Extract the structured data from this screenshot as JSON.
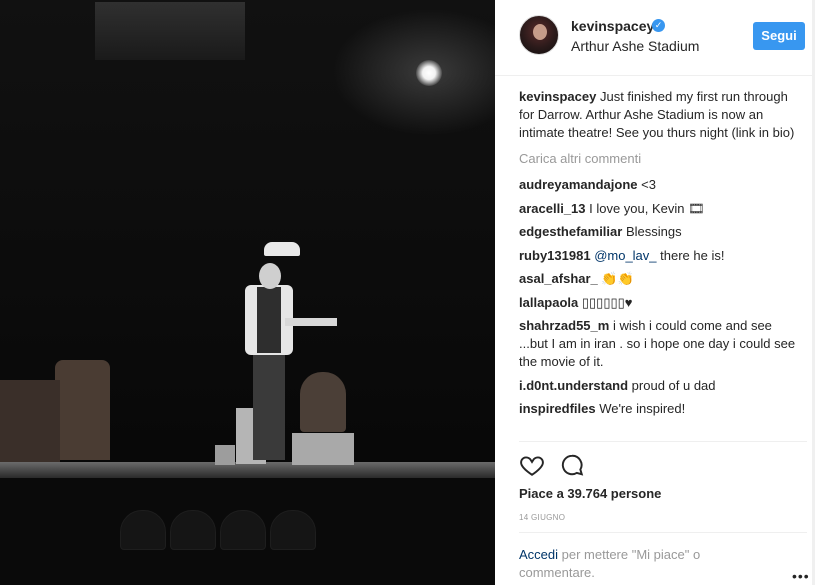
{
  "post": {
    "username": "kevinspacey",
    "location": "Arthur Ashe Stadium",
    "follow_label": "Segui",
    "caption": "Just finished my first run through for Darrow. Arthur Ashe Stadium is now an intimate theatre! See you thurs night (link in bio)",
    "load_more": "Carica altri commenti",
    "likes_text": "Piace a 39.764 persone",
    "date": "14 GIUGNO",
    "login_link": "Accedi",
    "login_rest": " per mettere \"Mi piace\" o commentare.",
    "more_glyph": "•••"
  },
  "comments": [
    {
      "user": "audreyamandajone",
      "text": " <3"
    },
    {
      "user": "aracelli_13",
      "text": " I love you, Kevin 🎞"
    },
    {
      "user": "edgesthefamiliar",
      "text": " Blessings"
    },
    {
      "user": "ruby131981",
      "mention": "@mo_lav_",
      "text": " there he is!"
    },
    {
      "user": "asal_afshar_",
      "text": " 👏👏"
    },
    {
      "user": "lallapaola",
      "text": " ▯▯▯▯▯▯♥"
    },
    {
      "user": "shahrzad55_m",
      "text": " i wish i could come and see ...but I am in iran . so i hope one day i could see the movie of it."
    },
    {
      "user": "i.d0nt.understand",
      "text": " proud of u dad"
    },
    {
      "user": "inspiredfiles",
      "text": " We're inspired!"
    }
  ],
  "icons": {
    "verified": "verified-badge-icon",
    "like": "heart-icon",
    "comment": "comment-bubble-icon",
    "more": "more-options-icon"
  },
  "colors": {
    "accent": "#3897f0",
    "link": "#003569",
    "muted": "#999999"
  }
}
